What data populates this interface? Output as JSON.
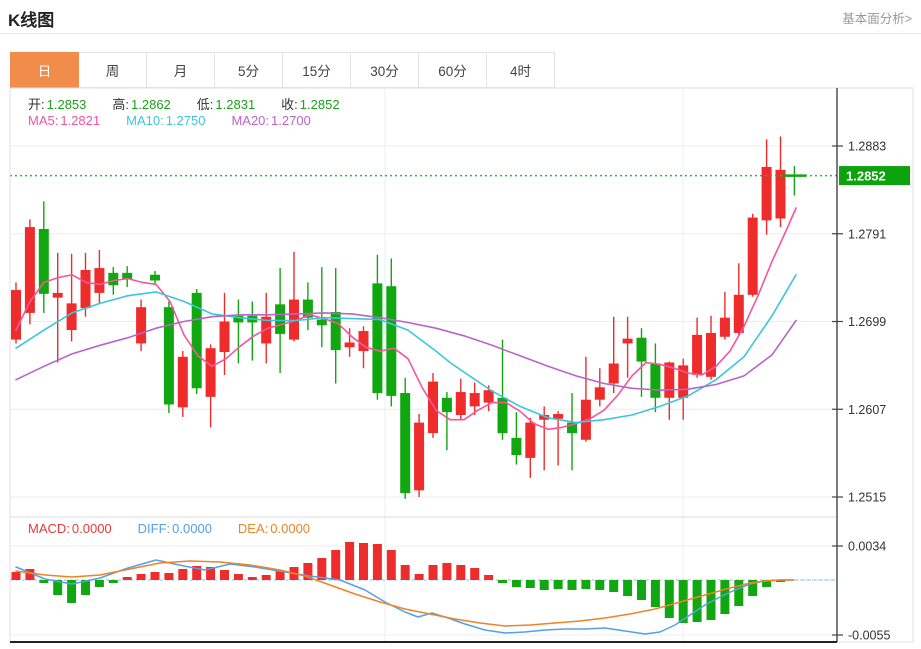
{
  "header": {
    "title": "K线图",
    "link_label": "基本面分析>"
  },
  "tabs": {
    "active_index": 0,
    "items": [
      "日",
      "周",
      "月",
      "5分",
      "15分",
      "30分",
      "60分",
      "4时"
    ]
  },
  "legend": {
    "ohlc": [
      {
        "label": "开:",
        "value": "1.2853"
      },
      {
        "label": "高:",
        "value": "1.2862"
      },
      {
        "label": "低:",
        "value": "1.2831"
      },
      {
        "label": "收:",
        "value": "1.2852"
      }
    ],
    "ma": [
      {
        "label": "MA5:",
        "value": "1.2821",
        "color": "#f4569b"
      },
      {
        "label": "MA10:",
        "value": "1.2750",
        "color": "#3cc6dc"
      },
      {
        "label": "MA20:",
        "value": "1.2700",
        "color": "#b964c8"
      }
    ],
    "macd": [
      {
        "label": "MACD:",
        "value": "0.0000",
        "color": "#e83939"
      },
      {
        "label": "DIFF:",
        "value": "0.0000",
        "color": "#55a0e6"
      },
      {
        "label": "DEA:",
        "value": "0.0000",
        "color": "#f08228"
      }
    ]
  },
  "colors": {
    "up": "#ee2c2c",
    "down": "#11a711",
    "ma5": "#f4569b",
    "ma10": "#3cc6dc",
    "ma20": "#b964c8",
    "diff": "#55a0e6",
    "dea": "#f08228",
    "ohlc_value": "#1ba11b",
    "grid": "#e9eef4",
    "frame": "#e2e2e2",
    "axis": "#444",
    "price_line": "#2db52d",
    "zero_line": "#b5d6ea",
    "tag_bg": "#0da30d",
    "tag_text": "#ffffff",
    "tick_text": "#333333",
    "tab_active_bg": "#f18c4a"
  },
  "chart_data": {
    "type": "candlestick+macd",
    "title": "K线图",
    "legend_position": "top-left",
    "grid": true,
    "price_axis": {
      "ticks": [
        1.2883,
        1.2791,
        1.2699,
        1.2607,
        1.2515
      ],
      "current_price": 1.2852,
      "current_label": "1.2852"
    },
    "macd_axis": {
      "ticks": [
        0.0034,
        -0.0055
      ]
    },
    "grid_v_x": [
      385,
      683
    ],
    "candles": [
      [
        1.268,
        1.274,
        1.2676,
        1.2732
      ],
      [
        1.2708,
        1.2806,
        1.2696,
        1.2798
      ],
      [
        1.2796,
        1.2825,
        1.2708,
        1.2728
      ],
      [
        1.2724,
        1.2771,
        1.2656,
        1.2729
      ],
      [
        1.269,
        1.277,
        1.2678,
        1.2718
      ],
      [
        1.2713,
        1.2771,
        1.2704,
        1.2753
      ],
      [
        1.2729,
        1.2774,
        1.2718,
        1.2755
      ],
      [
        1.275,
        1.2756,
        1.2727,
        1.2737
      ],
      [
        1.275,
        1.2757,
        1.2735,
        1.2743
      ],
      [
        1.2676,
        1.2722,
        1.2668,
        1.2714
      ],
      [
        1.2748,
        1.2752,
        1.2738,
        1.2742
      ],
      [
        1.2714,
        1.272,
        1.2603,
        1.2612
      ],
      [
        1.2609,
        1.2668,
        1.2599,
        1.2662
      ],
      [
        1.2729,
        1.2733,
        1.2623,
        1.2629
      ],
      [
        1.262,
        1.2675,
        1.2588,
        1.2671
      ],
      [
        1.2667,
        1.2729,
        1.2643,
        1.2699
      ],
      [
        1.2705,
        1.2722,
        1.2655,
        1.2698
      ],
      [
        1.2705,
        1.272,
        1.2658,
        1.2698
      ],
      [
        1.2676,
        1.2729,
        1.2655,
        1.2704
      ],
      [
        1.2717,
        1.2755,
        1.2645,
        1.2686
      ],
      [
        1.268,
        1.2772,
        1.2678,
        1.2722
      ],
      [
        1.2722,
        1.274,
        1.269,
        1.2703
      ],
      [
        1.2701,
        1.2756,
        1.2672,
        1.2695
      ],
      [
        1.2709,
        1.2755,
        1.2634,
        1.2669
      ],
      [
        1.2672,
        1.2692,
        1.2662,
        1.2677
      ],
      [
        1.2668,
        1.2694,
        1.265,
        1.2689
      ],
      [
        1.2739,
        1.2769,
        1.2617,
        1.2624
      ],
      [
        1.2736,
        1.2765,
        1.261,
        1.2621
      ],
      [
        1.2624,
        1.264,
        1.2513,
        1.2519
      ],
      [
        1.2522,
        1.2602,
        1.2515,
        1.2593
      ],
      [
        1.2582,
        1.2645,
        1.2577,
        1.2636
      ],
      [
        1.2619,
        1.2625,
        1.2564,
        1.2604
      ],
      [
        1.2601,
        1.2639,
        1.2596,
        1.2625
      ],
      [
        1.261,
        1.2635,
        1.2601,
        1.2624
      ],
      [
        1.2614,
        1.2632,
        1.2605,
        1.2627
      ],
      [
        1.2619,
        1.268,
        1.2575,
        1.2582
      ],
      [
        1.2577,
        1.2604,
        1.2549,
        1.2559
      ],
      [
        1.2556,
        1.2598,
        1.2535,
        1.2593
      ],
      [
        1.2596,
        1.261,
        1.2543,
        1.2601
      ],
      [
        1.2597,
        1.2605,
        1.2548,
        1.2602
      ],
      [
        1.2593,
        1.2624,
        1.2543,
        1.2582
      ],
      [
        1.2575,
        1.2662,
        1.2573,
        1.2617
      ],
      [
        1.2617,
        1.265,
        1.261,
        1.263
      ],
      [
        1.2634,
        1.2704,
        1.2624,
        1.2655
      ],
      [
        1.2676,
        1.2704,
        1.264,
        1.2681
      ],
      [
        1.2682,
        1.2692,
        1.262,
        1.2657
      ],
      [
        1.2655,
        1.2676,
        1.2604,
        1.2619
      ],
      [
        1.2619,
        1.2657,
        1.2596,
        1.2656
      ],
      [
        1.2619,
        1.266,
        1.2596,
        1.2653
      ],
      [
        1.2643,
        1.2703,
        1.264,
        1.2685
      ],
      [
        1.2641,
        1.2705,
        1.2638,
        1.2687
      ],
      [
        1.2683,
        1.273,
        1.268,
        1.2703
      ],
      [
        1.2687,
        1.276,
        1.2684,
        1.2727
      ],
      [
        1.2727,
        1.2812,
        1.2725,
        1.2808
      ],
      [
        1.2805,
        1.289,
        1.279,
        1.2861
      ],
      [
        1.2807,
        1.2893,
        1.2798,
        1.2858
      ],
      [
        1.2853,
        1.2862,
        1.2831,
        1.2852
      ]
    ],
    "ma5": [
      [
        16,
        1.269
      ],
      [
        30,
        1.272
      ],
      [
        44,
        1.274
      ],
      [
        58,
        1.2745
      ],
      [
        72,
        1.2748
      ],
      [
        86,
        1.274
      ],
      [
        100,
        1.2738
      ],
      [
        114,
        1.2742
      ],
      [
        128,
        1.2744
      ],
      [
        142,
        1.274
      ],
      [
        156,
        1.2738
      ],
      [
        170,
        1.272
      ],
      [
        184,
        1.2685
      ],
      [
        198,
        1.2663
      ],
      [
        212,
        1.2652
      ],
      [
        226,
        1.266
      ],
      [
        240,
        1.2673
      ],
      [
        254,
        1.2684
      ],
      [
        268,
        1.2692
      ],
      [
        282,
        1.2696
      ],
      [
        296,
        1.27
      ],
      [
        310,
        1.2706
      ],
      [
        324,
        1.2702
      ],
      [
        338,
        1.2697
      ],
      [
        352,
        1.2683
      ],
      [
        366,
        1.2672
      ],
      [
        380,
        1.2668
      ],
      [
        394,
        1.2671
      ],
      [
        408,
        1.266
      ],
      [
        422,
        1.263
      ],
      [
        436,
        1.2606
      ],
      [
        450,
        1.2596
      ],
      [
        464,
        1.2596
      ],
      [
        478,
        1.2606
      ],
      [
        492,
        1.2614
      ],
      [
        506,
        1.2614
      ],
      [
        520,
        1.2605
      ],
      [
        534,
        1.2592
      ],
      [
        548,
        1.2586
      ],
      [
        562,
        1.2588
      ],
      [
        576,
        1.2592
      ],
      [
        590,
        1.2597
      ],
      [
        604,
        1.2606
      ],
      [
        618,
        1.2622
      ],
      [
        632,
        1.2642
      ],
      [
        646,
        1.2656
      ],
      [
        660,
        1.2654
      ],
      [
        674,
        1.265
      ],
      [
        688,
        1.2645
      ],
      [
        702,
        1.2643
      ],
      [
        716,
        1.2652
      ],
      [
        730,
        1.2668
      ],
      [
        744,
        1.2694
      ],
      [
        758,
        1.2726
      ],
      [
        772,
        1.2762
      ],
      [
        786,
        1.2794
      ],
      [
        796,
        1.2818
      ]
    ],
    "ma10": [
      [
        16,
        1.2671
      ],
      [
        44,
        1.269
      ],
      [
        72,
        1.2708
      ],
      [
        100,
        1.2718
      ],
      [
        128,
        1.2726
      ],
      [
        156,
        1.273
      ],
      [
        184,
        1.272
      ],
      [
        212,
        1.2707
      ],
      [
        240,
        1.2703
      ],
      [
        268,
        1.27
      ],
      [
        296,
        1.27
      ],
      [
        324,
        1.2703
      ],
      [
        352,
        1.2702
      ],
      [
        380,
        1.2701
      ],
      [
        408,
        1.269
      ],
      [
        436,
        1.2668
      ],
      [
        450,
        1.2656
      ],
      [
        464,
        1.2646
      ],
      [
        492,
        1.2626
      ],
      [
        520,
        1.261
      ],
      [
        548,
        1.2598
      ],
      [
        576,
        1.2593
      ],
      [
        604,
        1.2596
      ],
      [
        632,
        1.2601
      ],
      [
        660,
        1.261
      ],
      [
        688,
        1.2621
      ],
      [
        716,
        1.2638
      ],
      [
        744,
        1.2662
      ],
      [
        772,
        1.2705
      ],
      [
        796,
        1.2748
      ]
    ],
    "ma20": [
      [
        16,
        1.2638
      ],
      [
        44,
        1.2652
      ],
      [
        72,
        1.2665
      ],
      [
        100,
        1.2674
      ],
      [
        128,
        1.2682
      ],
      [
        156,
        1.2692
      ],
      [
        184,
        1.2699
      ],
      [
        212,
        1.2704
      ],
      [
        240,
        1.2706
      ],
      [
        268,
        1.2706
      ],
      [
        296,
        1.2707
      ],
      [
        324,
        1.2708
      ],
      [
        352,
        1.2707
      ],
      [
        380,
        1.2703
      ],
      [
        408,
        1.2698
      ],
      [
        436,
        1.2692
      ],
      [
        464,
        1.2684
      ],
      [
        492,
        1.2674
      ],
      [
        520,
        1.2663
      ],
      [
        548,
        1.2652
      ],
      [
        576,
        1.2642
      ],
      [
        604,
        1.2634
      ],
      [
        632,
        1.2629
      ],
      [
        660,
        1.2627
      ],
      [
        688,
        1.2628
      ],
      [
        716,
        1.2633
      ],
      [
        744,
        1.2642
      ],
      [
        772,
        1.2664
      ],
      [
        796,
        1.27
      ]
    ],
    "macd_hist": [
      0.0008,
      0.0011,
      -0.0003,
      -0.0015,
      -0.0023,
      -0.0015,
      -0.0007,
      -0.0003,
      0.0003,
      0.0006,
      0.0008,
      0.0007,
      0.0011,
      0.0014,
      0.0013,
      0.001,
      0.0006,
      0.0003,
      0.0005,
      0.0009,
      0.0013,
      0.0017,
      0.0022,
      0.003,
      0.0038,
      0.0037,
      0.0036,
      0.003,
      0.0015,
      0.0006,
      0.0015,
      0.0017,
      0.0015,
      0.0012,
      0.0005,
      -0.0003,
      -0.0007,
      -0.0008,
      -0.001,
      -0.0009,
      -0.001,
      -0.0009,
      -0.001,
      -0.0012,
      -0.0016,
      -0.002,
      -0.0027,
      -0.0038,
      -0.0043,
      -0.0042,
      -0.004,
      -0.0034,
      -0.0026,
      -0.0016,
      -0.0007,
      -0.0002,
      0.0
    ],
    "diff": [
      [
        16,
        0.0013
      ],
      [
        45,
        0.0001
      ],
      [
        72,
        -0.0004
      ],
      [
        100,
        0.0002
      ],
      [
        128,
        0.0012
      ],
      [
        156,
        0.002
      ],
      [
        184,
        0.0014
      ],
      [
        205,
        0.001
      ],
      [
        230,
        0.0016
      ],
      [
        255,
        0.0013
      ],
      [
        285,
        0.0008
      ],
      [
        310,
        0.0004
      ],
      [
        340,
        0.0
      ],
      [
        365,
        -0.001
      ],
      [
        385,
        -0.0022
      ],
      [
        405,
        -0.0032
      ],
      [
        418,
        -0.0037
      ],
      [
        432,
        -0.0033
      ],
      [
        448,
        -0.0038
      ],
      [
        465,
        -0.0044
      ],
      [
        485,
        -0.005
      ],
      [
        505,
        -0.0053
      ],
      [
        525,
        -0.0052
      ],
      [
        545,
        -0.005
      ],
      [
        565,
        -0.0049
      ],
      [
        585,
        -0.0049
      ],
      [
        605,
        -0.0048
      ],
      [
        625,
        -0.0051
      ],
      [
        645,
        -0.0054
      ],
      [
        660,
        -0.0052
      ],
      [
        675,
        -0.0045
      ],
      [
        690,
        -0.0035
      ],
      [
        705,
        -0.0025
      ],
      [
        720,
        -0.0017
      ],
      [
        735,
        -0.001
      ],
      [
        750,
        -0.0004
      ],
      [
        765,
        -0.0001
      ],
      [
        780,
        0.0
      ],
      [
        794,
        0.0
      ]
    ],
    "dea": [
      [
        16,
        0.0009
      ],
      [
        45,
        0.0005
      ],
      [
        72,
        0.0003
      ],
      [
        100,
        0.0005
      ],
      [
        130,
        0.0011
      ],
      [
        160,
        0.0017
      ],
      [
        190,
        0.0019
      ],
      [
        220,
        0.0018
      ],
      [
        250,
        0.0015
      ],
      [
        280,
        0.001
      ],
      [
        305,
        0.0004
      ],
      [
        330,
        -0.0005
      ],
      [
        355,
        -0.0014
      ],
      [
        380,
        -0.0022
      ],
      [
        405,
        -0.0029
      ],
      [
        430,
        -0.0034
      ],
      [
        455,
        -0.0039
      ],
      [
        480,
        -0.0043
      ],
      [
        505,
        -0.0046
      ],
      [
        530,
        -0.0045
      ],
      [
        555,
        -0.0043
      ],
      [
        580,
        -0.0041
      ],
      [
        605,
        -0.0038
      ],
      [
        630,
        -0.0034
      ],
      [
        655,
        -0.0029
      ],
      [
        680,
        -0.0022
      ],
      [
        705,
        -0.0015
      ],
      [
        730,
        -0.0008
      ],
      [
        750,
        -0.0003
      ],
      [
        765,
        -0.0001
      ],
      [
        780,
        0.0
      ],
      [
        794,
        0.0
      ]
    ]
  }
}
